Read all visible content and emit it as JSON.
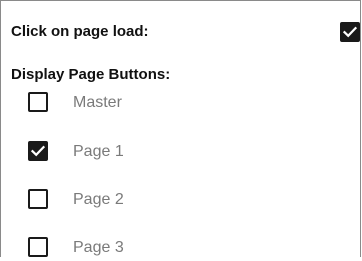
{
  "settings": {
    "click_on_load_label": "Click on page load:",
    "click_on_load_checked": true,
    "display_buttons_label": "Display Page Buttons:"
  },
  "pages": [
    {
      "label": "Master",
      "checked": false
    },
    {
      "label": "Page 1",
      "checked": true
    },
    {
      "label": "Page 2",
      "checked": false
    },
    {
      "label": "Page 3",
      "checked": false
    }
  ],
  "icons": {
    "checkmark": "checkmark-icon"
  },
  "colors": {
    "checkbox_border": "#1a1a1a",
    "checkbox_fill_checked": "#1a1a1a",
    "label_muted": "#7a7a7a",
    "heading": "#111111"
  }
}
